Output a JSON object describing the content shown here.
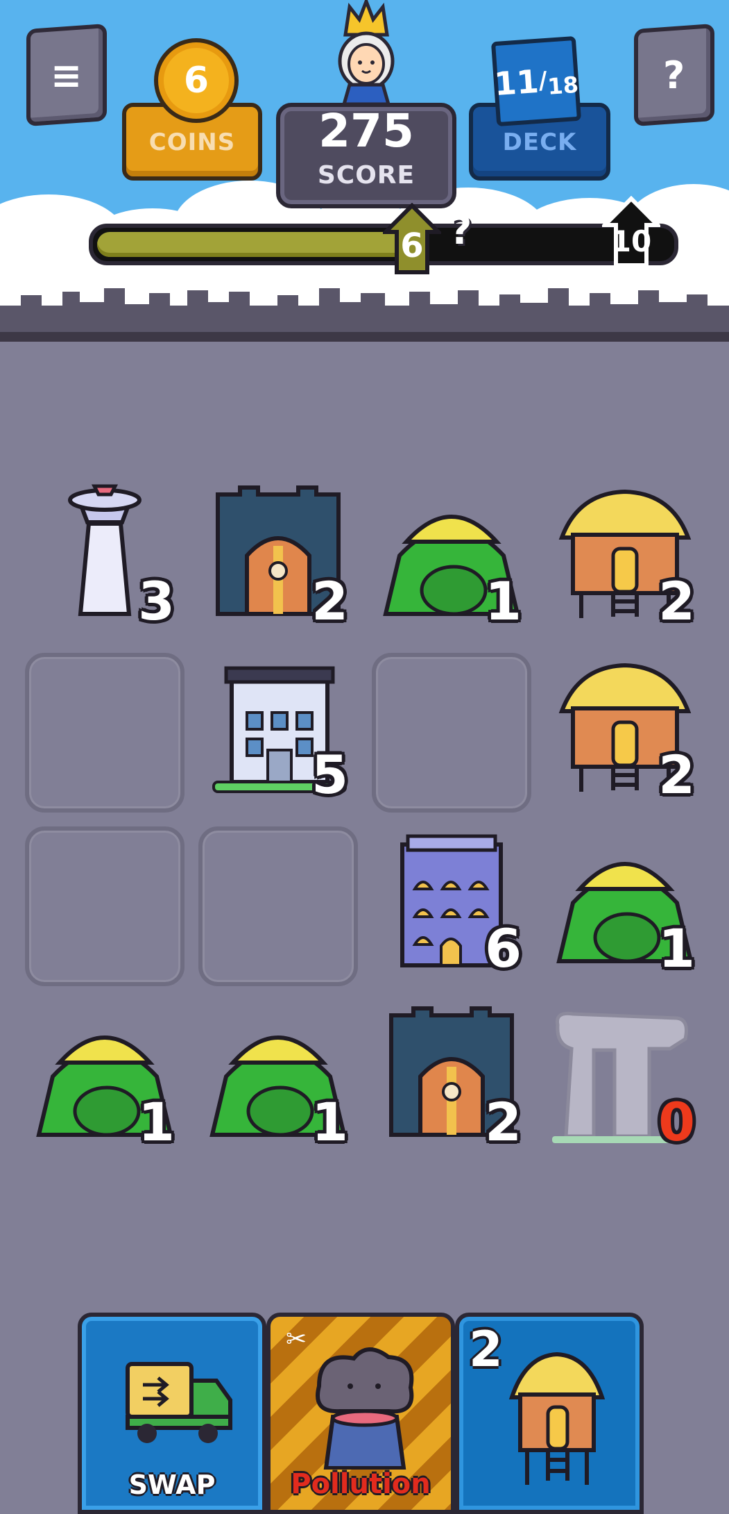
{
  "hud": {
    "menu_icon": "≡",
    "help_icon": "?",
    "coins": {
      "value": "6",
      "label": "COINS"
    },
    "score": {
      "value": "275",
      "label": "SCORE"
    },
    "deck": {
      "count": "11",
      "total": "18",
      "label": "DECK"
    }
  },
  "progress": {
    "current_marker": "6",
    "next_marker": "10",
    "mystery": "?",
    "fill_fraction": 0.56
  },
  "board": {
    "rows": [
      [
        {
          "building": "observation-tower",
          "level": "3"
        },
        {
          "building": "castle",
          "level": "2"
        },
        {
          "building": "tent",
          "level": "1"
        },
        {
          "building": "stilt-hut",
          "level": "2"
        }
      ],
      [
        {
          "building": "empty",
          "level": ""
        },
        {
          "building": "office-building",
          "level": "5"
        },
        {
          "building": "empty",
          "level": ""
        },
        {
          "building": "stilt-hut",
          "level": "2"
        }
      ],
      [
        {
          "building": "empty",
          "level": ""
        },
        {
          "building": "empty",
          "level": ""
        },
        {
          "building": "apartment-building",
          "level": "6"
        },
        {
          "building": "tent",
          "level": "1"
        }
      ],
      [
        {
          "building": "tent",
          "level": "1"
        },
        {
          "building": "tent",
          "level": "1"
        },
        {
          "building": "castle",
          "level": "2"
        },
        {
          "building": "ruins",
          "level": "0"
        }
      ]
    ]
  },
  "hand": {
    "swap": {
      "label": "SWAP",
      "icon": "truck-icon"
    },
    "pollution": {
      "label": "Pollution",
      "icon": "factory-smoke-icon"
    },
    "building": {
      "cost": "2",
      "icon": "stilt-hut-icon"
    }
  },
  "colors": {
    "sky": "#58b3ee",
    "ground": "#817f96",
    "coin": "#f4b21e",
    "deck": "#19539a",
    "progress": "#a2a338"
  }
}
